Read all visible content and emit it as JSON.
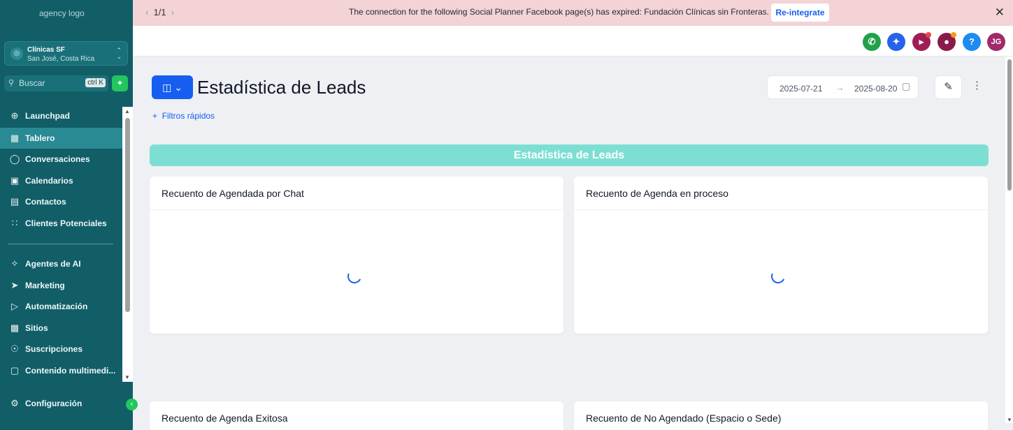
{
  "sidebar": {
    "logo_alt": "agency logo",
    "location": {
      "name": "Clínicas SF",
      "address": "San José, Costa Rica"
    },
    "search": {
      "placeholder": "Buscar",
      "shortcut": "ctrl K"
    },
    "items": [
      {
        "label": "Launchpad",
        "icon": "rocket-icon"
      },
      {
        "label": "Tablero",
        "icon": "dashboard-icon"
      },
      {
        "label": "Conversaciones",
        "icon": "chat-icon"
      },
      {
        "label": "Calendarios",
        "icon": "calendar-icon"
      },
      {
        "label": "Contactos",
        "icon": "contacts-icon"
      },
      {
        "label": "Clientes Potenciales",
        "icon": "leads-icon"
      },
      {
        "label": "Agentes de AI",
        "icon": "sparkle-icon"
      },
      {
        "label": "Marketing",
        "icon": "send-icon"
      },
      {
        "label": "Automatización",
        "icon": "automation-icon"
      },
      {
        "label": "Sitios",
        "icon": "site-icon"
      },
      {
        "label": "Suscripciones",
        "icon": "badge-icon"
      },
      {
        "label": "Contenido multimedi...",
        "icon": "image-icon"
      }
    ],
    "settings_label": "Configuración"
  },
  "banner": {
    "pager": "1/1",
    "message": "The connection for the following Social Planner Facebook page(s) has expired: Fundación Clínicas sin Fronteras.",
    "action": "Re-integrate"
  },
  "topbar": {
    "avatar_initials": "JG",
    "help": "?",
    "colors": {
      "phone": "#22a04b",
      "magic": "#2563eb",
      "announce": "#9f1d55",
      "bell": "#8b1a4a",
      "help": "#1d8cf0",
      "avatar": "#a12a6a"
    }
  },
  "page": {
    "title": "Estadística de Leads",
    "quick_filters": "Filtros rápidos",
    "date_start": "2025-07-21",
    "date_end": "2025-08-20",
    "section_title": "Estadística de Leads",
    "cards": [
      {
        "title": "Recuento de Agendada por Chat"
      },
      {
        "title": "Recuento de Agenda en proceso"
      },
      {
        "title": "Recuento de Agenda Exitosa"
      },
      {
        "title": "Recuento de No Agendado (Espacio o Sede)"
      }
    ],
    "accent": "#155eef",
    "section_color": "#7ddfd3"
  }
}
